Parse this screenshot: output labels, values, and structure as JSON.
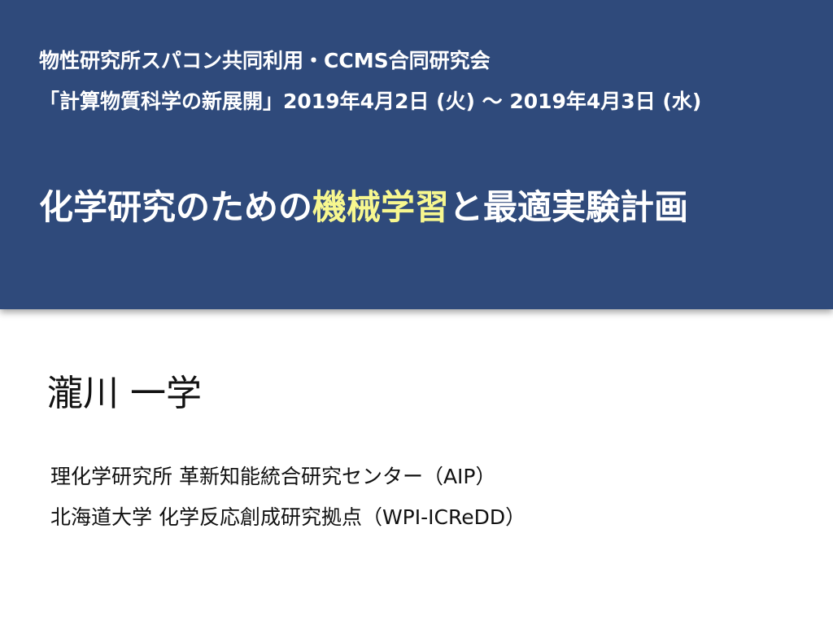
{
  "colors": {
    "header_background": "#2f4a7b",
    "header_text": "#ffffff",
    "title_highlight": "#f7f78f",
    "body_text": "#111111"
  },
  "header": {
    "event_line_1": "物性研究所スパコン共同利用・CCMS合同研究会",
    "event_line_2": "「計算物質科学の新展開」2019年4月2日 (火) 〜 2019年4月3日 (水)",
    "title_part_1": "化学研究のための",
    "title_highlight": "機械学習",
    "title_part_2": "と最適実験計画"
  },
  "speaker": {
    "name": "瀧川 一学",
    "affiliations": [
      "理化学研究所 革新知能統合研究センター（AIP）",
      "北海道大学 化学反応創成研究拠点（WPI-ICReDD）"
    ]
  }
}
